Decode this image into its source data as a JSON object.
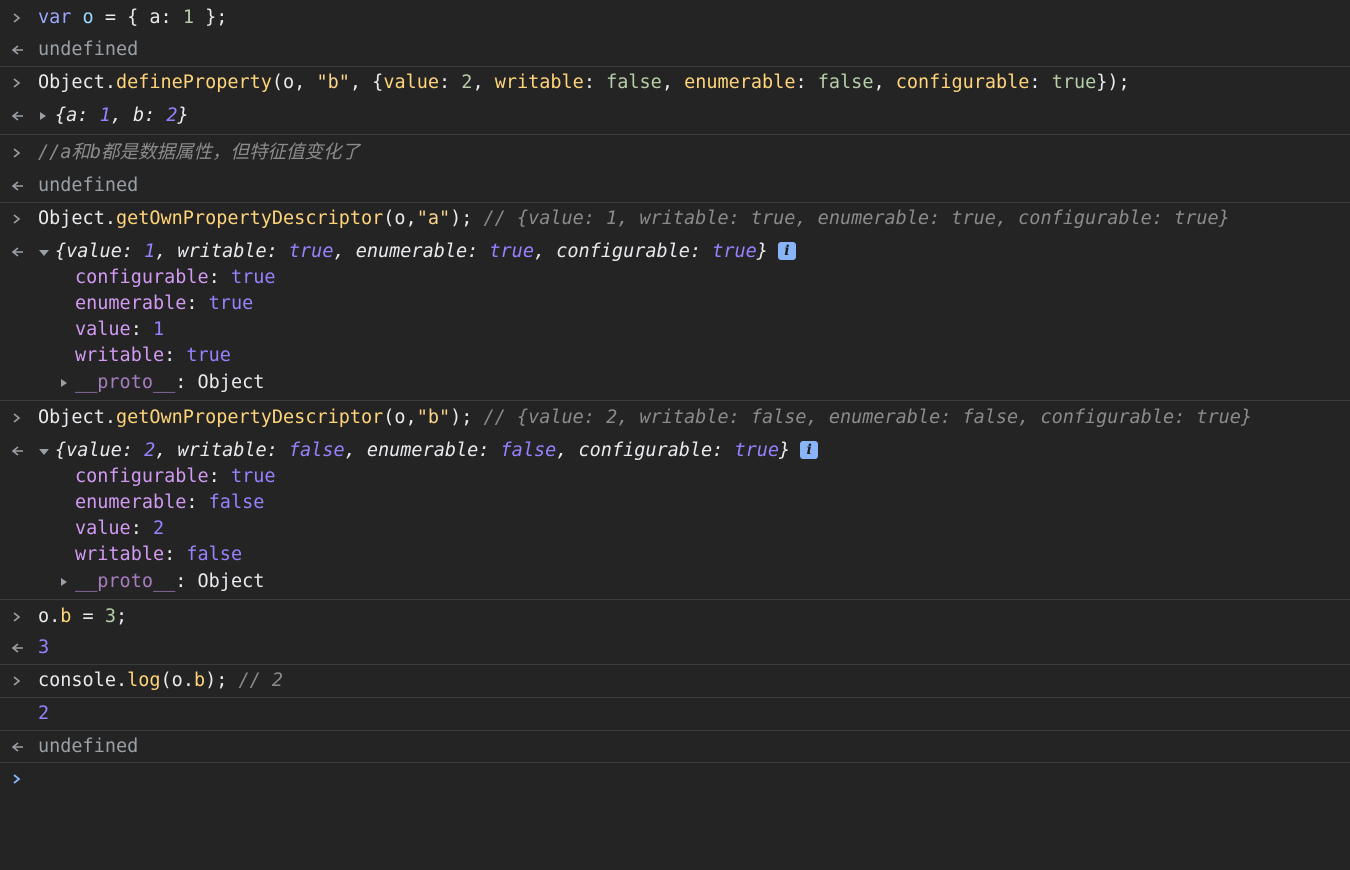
{
  "colors": {
    "background": "#242424",
    "separator": "#3c3c3c",
    "keyword": "#9aa7ff",
    "string": "#f28b54",
    "function": "#ffd479",
    "number": "#9980ff",
    "property_key": "#d29af2",
    "comment": "#8b8b8b",
    "prompt": "#8ab4f8"
  },
  "icons": {
    "input_prompt": "chevron-right-icon",
    "output_prompt": "return-arrow-icon",
    "expand": "triangle-right-icon",
    "collapse": "triangle-down-icon",
    "info": "info-icon"
  },
  "console": {
    "undefined_text": "undefined",
    "l1": {
      "a": "var",
      "b": " o ",
      "c": "= { ",
      "d": "a",
      "e": ": ",
      "f": "1",
      "g": " };"
    },
    "l3": {
      "a": "Object",
      "b": ".",
      "c": "defineProperty",
      "d": "(o, ",
      "e": "\"b\"",
      "f": ", {",
      "g": "value",
      "h": ": ",
      "i": "2",
      "j": ", ",
      "k": "writable",
      "l": ": ",
      "m": "false",
      "n": ", ",
      "o": "enumerable",
      "p": ": ",
      "q": "false",
      "r": ", ",
      "s": "configurable",
      "t": ": ",
      "u": "true",
      "v": "});"
    },
    "l4": {
      "a": "{a: ",
      "b": "1",
      "c": ", b: ",
      "d": "2",
      "e": "}"
    },
    "l5": {
      "a": "//a和b都是数据属性，但特征值变化了"
    },
    "l7": {
      "a": "Object",
      "b": ".",
      "c": "getOwnPropertyDescriptor",
      "d": "(o,",
      "e": "\"a\"",
      "f": "); ",
      "g": "// {value: 1, writable: true, enumerable: true, configurable: true}"
    },
    "l8": {
      "a": "{value: ",
      "b": "1",
      "c": ", writable: ",
      "d": "true",
      "e": ", enumerable: ",
      "f": "true",
      "g": ", configurable: ",
      "h": "true",
      "i": "}",
      "info": "i"
    },
    "a_props": [
      {
        "key": "configurable",
        "value": "true"
      },
      {
        "key": "enumerable",
        "value": "true"
      },
      {
        "key": "value",
        "value": "1"
      },
      {
        "key": "writable",
        "value": "true"
      }
    ],
    "proto_key": "__proto__",
    "proto_val": ": Object",
    "l14": {
      "a": "Object",
      "b": ".",
      "c": "getOwnPropertyDescriptor",
      "d": "(o,",
      "e": "\"b\"",
      "f": "); ",
      "g": "// {value: 2, writable: false, enumerable: false, configurable: true}"
    },
    "l15": {
      "a": "{value: ",
      "b": "2",
      "c": ", writable: ",
      "d": "false",
      "e": ", enumerable: ",
      "f": "false",
      "g": ", configurable: ",
      "h": "true",
      "i": "}",
      "info": "i"
    },
    "b_props": [
      {
        "key": "configurable",
        "value": "true"
      },
      {
        "key": "enumerable",
        "value": "false"
      },
      {
        "key": "value",
        "value": "2"
      },
      {
        "key": "writable",
        "value": "false"
      }
    ],
    "l21": {
      "a": "o",
      "b": ".",
      "c": "b",
      "d": " = ",
      "e": "3",
      "f": ";"
    },
    "l22": {
      "a": "3"
    },
    "l23": {
      "a": "console",
      "b": ".",
      "c": "log",
      "d": "(o",
      "e": ".",
      "f": "b",
      "g": "); ",
      "h": "// 2"
    },
    "l24": {
      "a": "2"
    }
  }
}
